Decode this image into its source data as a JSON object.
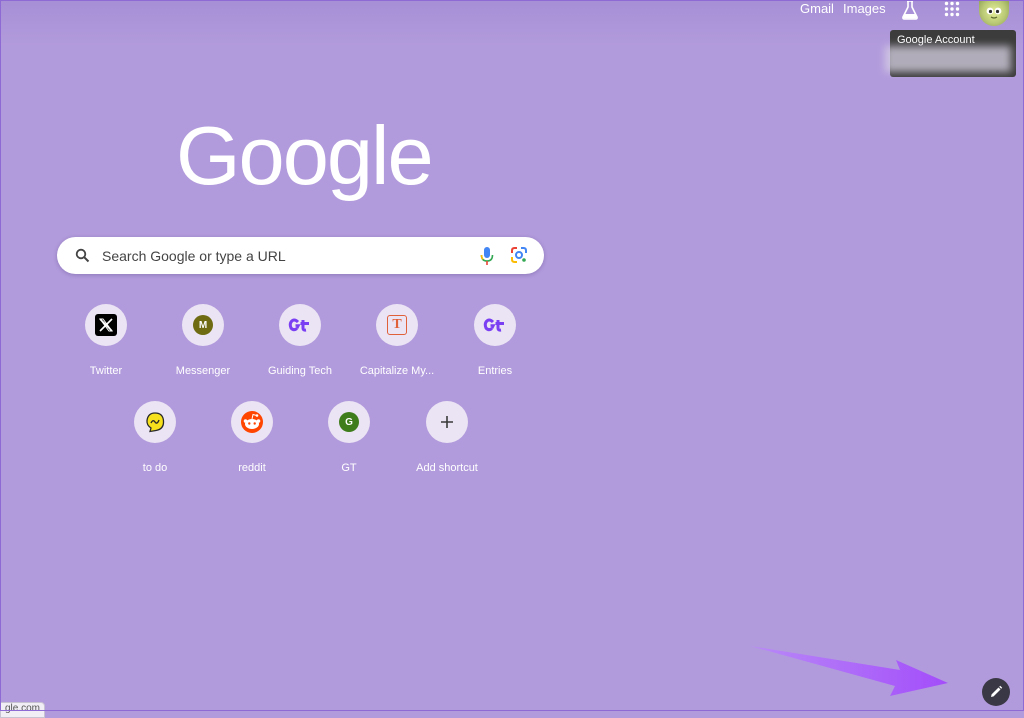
{
  "topbar": {
    "gmail": "Gmail",
    "images": "Images",
    "labs_icon": "flask-icon",
    "apps_icon": "apps-grid-icon",
    "avatar_icon": "account-avatar"
  },
  "tooltip": {
    "title": "Google Account"
  },
  "logo": "Google",
  "search": {
    "placeholder": "Search Google or type a URL",
    "voice_icon": "mic-icon",
    "lens_icon": "google-lens-icon"
  },
  "shortcuts": [
    {
      "label": "Twitter",
      "icon": "x-logo-icon"
    },
    {
      "label": "Messenger",
      "icon": "m-letter-icon",
      "letter": "M"
    },
    {
      "label": "Guiding Tech",
      "icon": "guiding-tech-icon"
    },
    {
      "label": "Capitalize My...",
      "icon": "capitalize-t-icon",
      "letter": "T"
    },
    {
      "label": "Entries",
      "icon": "guiding-tech-icon"
    },
    {
      "label": "to do",
      "icon": "todo-icon"
    },
    {
      "label": "reddit",
      "icon": "reddit-icon"
    },
    {
      "label": "GT",
      "icon": "g-letter-icon",
      "letter": "G"
    },
    {
      "label": "Add shortcut",
      "icon": "plus-icon"
    }
  ],
  "customize": {
    "icon": "pencil-icon"
  },
  "status_bar": {
    "url": "gle.com"
  },
  "colors": {
    "background": "#b29bdc",
    "arrow": "#a34dfa",
    "edit_button": "#3b3846"
  }
}
